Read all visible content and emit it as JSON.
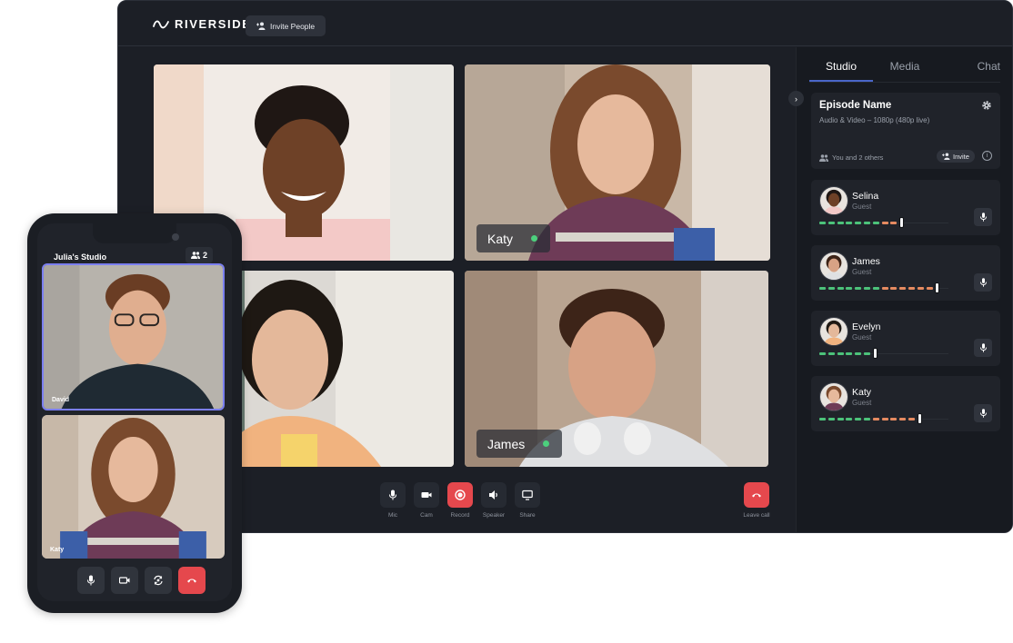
{
  "desktop": {
    "brand": "RIVERSIDE",
    "invite_people": "Invite People",
    "tiles": [
      {
        "person": "Selina",
        "show_tag": false
      },
      {
        "person": "Katy",
        "show_tag": true,
        "tag": "Katy"
      },
      {
        "person": "Evelyn",
        "show_tag": false
      },
      {
        "person": "James",
        "show_tag": true,
        "tag": "James"
      }
    ],
    "controls": [
      {
        "label": "Mic",
        "icon": "mic-icon"
      },
      {
        "label": "Cam",
        "icon": "camera-icon"
      },
      {
        "label": "Record",
        "icon": "record-icon"
      },
      {
        "label": "Speaker",
        "icon": "speaker-icon"
      },
      {
        "label": "Share",
        "icon": "screen-share-icon"
      }
    ],
    "leave_call": "Leave call"
  },
  "panel": {
    "tabs": [
      {
        "label": "Studio",
        "active": true
      },
      {
        "label": "Media",
        "active": false
      },
      {
        "label": "Chat",
        "active": false
      }
    ],
    "episode": {
      "title": "Episode Name",
      "subtitle": "Audio & Video – 1080p (480p live)",
      "participants": "You and 2 others",
      "invite": "Invite",
      "info": "i"
    },
    "guests": [
      {
        "name": "Selina",
        "role": "Guest",
        "level": 0.64,
        "green_segments": 7,
        "orange_segments": 2
      },
      {
        "name": "James",
        "role": "Guest",
        "level": 0.9,
        "green_segments": 7,
        "orange_segments": 6
      },
      {
        "name": "Evelyn",
        "role": "Guest",
        "level": 0.43,
        "green_segments": 6,
        "orange_segments": 0
      },
      {
        "name": "Katy",
        "role": "Guest",
        "level": 0.76,
        "green_segments": 6,
        "orange_segments": 5
      }
    ]
  },
  "phone": {
    "studio_name": "Julia's Studio",
    "participant_count": "2",
    "tiles": [
      {
        "name": "David",
        "active": true
      },
      {
        "name": "Katy",
        "active": false
      }
    ]
  },
  "colors": {
    "accent_blue": "#4a66c9",
    "live_green": "#4cd07d",
    "meter_green": "#4cc27a",
    "meter_orange": "#e58a60",
    "danger_red": "#e5484d",
    "active_outline": "#7b7ff0"
  }
}
